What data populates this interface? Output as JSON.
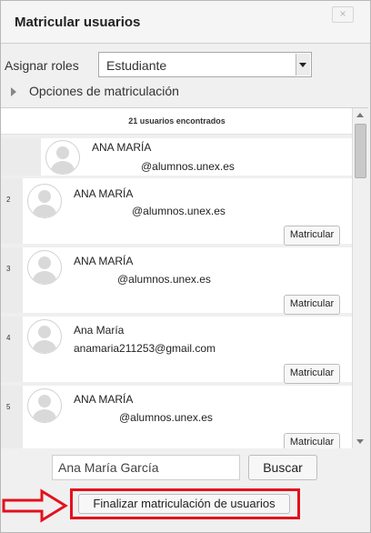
{
  "dialog": {
    "title": "Matricular usuarios",
    "close_label": "×"
  },
  "roles": {
    "label": "Asignar roles",
    "selected": "Estudiante"
  },
  "options": {
    "label": "Opciones de matriculación"
  },
  "list": {
    "header": "21 usuarios encontrados",
    "rows": [
      {
        "num": "",
        "name": "ANA MARÍA",
        "email": "@alumnos.unex.es",
        "button": ""
      },
      {
        "num": "2",
        "name": "ANA MARÍA",
        "email": "@alumnos.unex.es",
        "button": "Matricular"
      },
      {
        "num": "3",
        "name": "ANA MARÍA",
        "email": "@alumnos.unex.es",
        "button": "Matricular"
      },
      {
        "num": "4",
        "name": "Ana María",
        "email": "anamaria211253@gmail.com",
        "button": "Matricular"
      },
      {
        "num": "5",
        "name": "ANA MARÍA",
        "email": "@alumnos.unex.es",
        "button": "Matricular"
      }
    ]
  },
  "search": {
    "value": "Ana María García",
    "button_label": "Buscar"
  },
  "finish": {
    "button_label": "Finalizar matriculación de usuarios"
  },
  "colors": {
    "highlight": "#e2121d",
    "arrow": "#e2121d"
  },
  "icons": {
    "close": "close-icon",
    "expand": "triangle-right-icon",
    "dropdown": "chevron-down-icon",
    "avatar": "user-avatar-icon"
  }
}
